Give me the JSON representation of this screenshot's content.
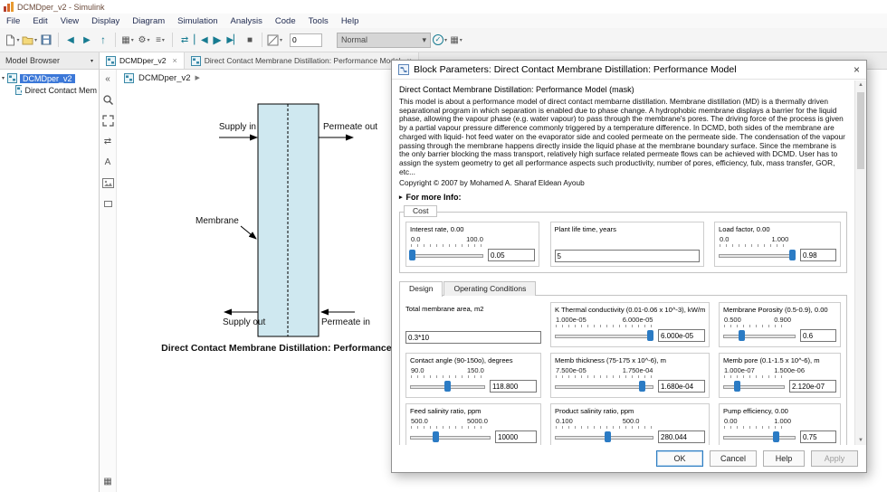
{
  "window": {
    "title": "DCMDper_v2 - Simulink"
  },
  "menu": {
    "items": [
      "File",
      "Edit",
      "View",
      "Display",
      "Diagram",
      "Simulation",
      "Analysis",
      "Code",
      "Tools",
      "Help"
    ]
  },
  "toolbar": {
    "zoom_value": "0",
    "sim_mode": "Normal"
  },
  "tabstrip": {
    "browser_label": "Model Browser",
    "tabs": [
      {
        "label": "DCMDper_v2"
      },
      {
        "label": "Direct Contact Membrane Distillation: Performance Model"
      }
    ]
  },
  "model_browser": {
    "root": "DCMDper_v2",
    "child": "Direct Contact Mem"
  },
  "canvas": {
    "breadcrumb": "DCMDper_v2",
    "diagram": {
      "supply_in": "Supply in",
      "permeate_out": "Permeate out",
      "membrane": "Membrane",
      "supply_out": "Supply out",
      "permeate_in": "Permeate in",
      "caption": "Direct Contact Membrane Distillation: Performance Model"
    }
  },
  "dialog": {
    "title": "Block Parameters: Direct Contact Membrane Distillation: Performance Model",
    "mask_header": "Direct Contact Membrane Distillation: Performance Model (mask)",
    "description": "This model is about a performance model of direct contact membarne distillation. Membrane distillation (MD) is a thermally driven separational program in which separation is enabled due to phase change. A hydrophobic membrane displays a barrier for the liquid phase, allowing the vapour phase (e.g. water vapour) to pass through the membrane's pores. The driving force of the process is given by a partial vapour pressure difference commonly triggered by a temperature difference. In DCMD, both sides of the membrane are charged with liquid- hot feed water on the evaporator side and cooled permeate on the permeate side. The condensation of the vapour passing through the membrane happens directly inside the liquid phase at the membrane boundary surface. Since the membrane is the only barrier blocking the mass transport, relatively high surface related permeate flows can be achieved with DCMD. User has to assign the system geometry to get all performance aspects such productivity, number of pores, efficiency, fulx, mass transfer, GOR, etc...",
    "copyright": "Copyright © 2007 by Mohamed A. Sharaf Eldean Ayoub",
    "more_info": "For more Info:",
    "cost_group": {
      "label": "Cost",
      "interest": {
        "label": "Interest rate, 0.00",
        "min": "0.0",
        "max": "100.0",
        "value": "0.05",
        "percent": 3
      },
      "plant_life": {
        "label": "Plant life time, years",
        "value": "5"
      },
      "load_factor": {
        "label": "Load factor, 0.00",
        "min": "0.0",
        "max": "1.000",
        "value": "0.98",
        "percent": 95
      }
    },
    "tabs": {
      "design": "Design",
      "operating": "Operating Conditions"
    },
    "design": {
      "area": {
        "label": "Total membrane area, m2",
        "value": "0.3*10"
      },
      "k_thermal": {
        "label": "K Thermal conductivity (0.01-0.06 x 10^-3), kW/moC",
        "min": "1.000e-05",
        "max": "6.000e-05",
        "value": "6.000e-05",
        "percent": 96
      },
      "porosity": {
        "label": "Membrane Porosity (0.5-0.9), 0.00",
        "min": "0.500",
        "max": "0.900",
        "value": "0.6",
        "percent": 25
      },
      "contact_angle": {
        "label": "Contact angle (90-150o), degrees",
        "min": "90.0",
        "max": "150.0",
        "value": "118.800",
        "percent": 49
      },
      "thickness": {
        "label": "Memb thickness (75-175 x 10^-6), m",
        "min": "7.500e-05",
        "max": "1.750e-04",
        "value": "1.680e-04",
        "percent": 88
      },
      "pore": {
        "label": "Memb pore (0.1-1.5 x 10^-6), m",
        "min": "1.000e-07",
        "max": "1.500e-06",
        "value": "2.120e-07",
        "percent": 22
      },
      "feed_salinity": {
        "label": "Feed salinity ratio, ppm",
        "min": "500.0",
        "max": "5000.0",
        "value": "10000",
        "percent": 32
      },
      "product_salinity": {
        "label": "Product salinity ratio, ppm",
        "min": "0.100",
        "max": "500.0",
        "value": "280.044",
        "percent": 53
      },
      "pump_eff": {
        "label": "Pump efficiency, 0.00",
        "min": "0.00",
        "max": "1.000",
        "value": "0.75",
        "percent": 72
      }
    },
    "buttons": {
      "ok": "OK",
      "cancel": "Cancel",
      "help": "Help",
      "apply": "Apply"
    }
  },
  "icons": {
    "caret": "▾",
    "close": "×",
    "back": "◀",
    "forward": "▶",
    "up": "↑",
    "play": "▶",
    "stop": "■",
    "gear": "⚙",
    "menu": "≡",
    "check": "✓",
    "grid": "▦",
    "collapse": "«",
    "bc_arrow": "▶",
    "more_info": "▸",
    "swap": "⇄",
    "step_back": "▏◀",
    "step_fwd": "▶▏",
    "annotation": "A",
    "scroll_up": "▲",
    "scroll_down": "▼",
    "tree_caret": "▾"
  }
}
